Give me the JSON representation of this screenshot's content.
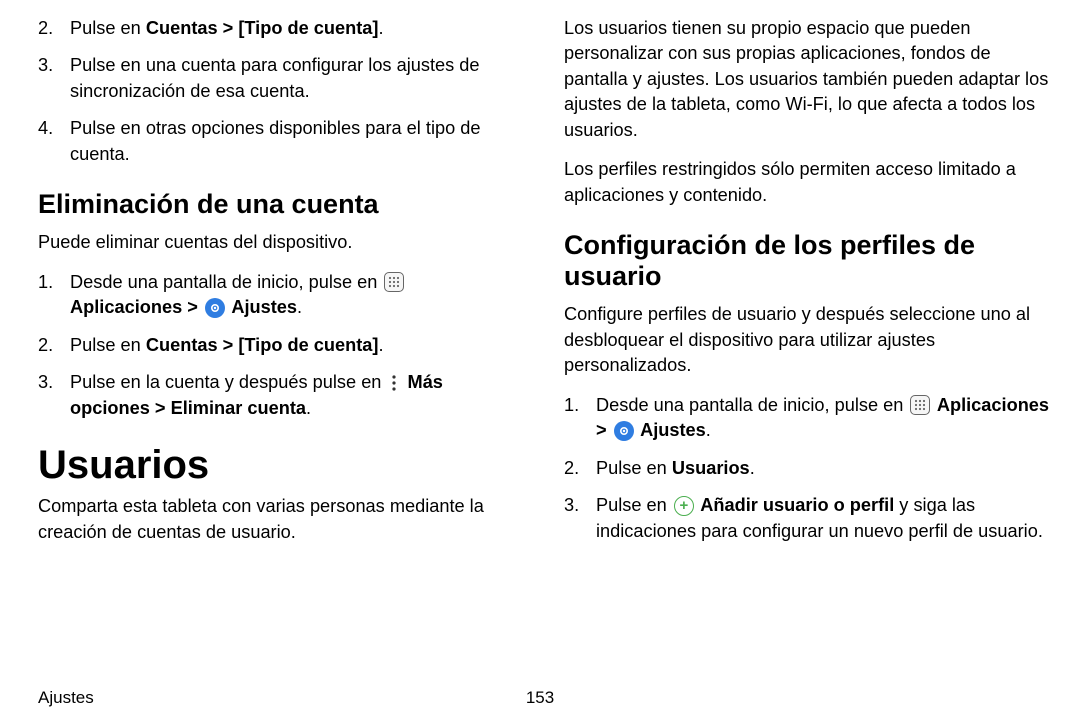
{
  "left": {
    "steps_top": [
      {
        "num": "2.",
        "pre": "Pulse en ",
        "bold": "Cuentas > [Tipo de cuenta]",
        "post": "."
      },
      {
        "num": "3.",
        "pre": "Pulse en una cuenta para configurar los ajustes de sincronización de esa cuenta.",
        "bold": "",
        "post": ""
      },
      {
        "num": "4.",
        "pre": "Pulse en otras opciones disponibles para el tipo de cuenta.",
        "bold": "",
        "post": ""
      }
    ],
    "h2_delete": "Eliminación de una cuenta",
    "p_delete": "Puede eliminar cuentas del dispositivo.",
    "steps_delete": [
      {
        "num": "1.",
        "segments": [
          {
            "t": "Desde una pantalla de inicio, pulse en "
          },
          {
            "icon": "apps"
          },
          {
            "t": " Aplicaciones > ",
            "bold": true
          },
          {
            "icon": "settings"
          },
          {
            "t": " Ajustes",
            "bold": true
          },
          {
            "t": "."
          }
        ]
      },
      {
        "num": "2.",
        "segments": [
          {
            "t": "Pulse en "
          },
          {
            "t": "Cuentas > [Tipo de cuenta]",
            "bold": true
          },
          {
            "t": "."
          }
        ]
      },
      {
        "num": "3.",
        "segments": [
          {
            "t": "Pulse en la cuenta y después pulse en "
          },
          {
            "icon": "more"
          },
          {
            "t": " Más opciones > Eliminar cuenta",
            "bold": true
          },
          {
            "t": "."
          }
        ]
      }
    ],
    "h1_users": "Usuarios",
    "p_users": "Comparta esta tableta con varias personas mediante la creación de cuentas de usuario."
  },
  "right": {
    "p1": "Los usuarios tienen su propio espacio que pueden personalizar con sus propias aplicaciones, fondos de pantalla y ajustes. Los usuarios también pueden adaptar los ajustes de la tableta, como Wi-Fi, lo que afecta a todos los usuarios.",
    "p2": "Los perfiles restringidos sólo permiten acceso limitado a aplicaciones y contenido.",
    "h2_profiles": "Configuración de los perfiles de usuario",
    "p3": "Configure perfiles de usuario y después seleccione uno al desbloquear el dispositivo para utilizar ajustes personalizados.",
    "steps_profiles": [
      {
        "num": "1.",
        "segments": [
          {
            "t": "Desde una pantalla de inicio, pulse en "
          },
          {
            "icon": "apps"
          },
          {
            "t": " Aplicaciones > ",
            "bold": true
          },
          {
            "icon": "settings"
          },
          {
            "t": " Ajustes",
            "bold": true
          },
          {
            "t": "."
          }
        ]
      },
      {
        "num": "2.",
        "segments": [
          {
            "t": "Pulse en "
          },
          {
            "t": "Usuarios",
            "bold": true
          },
          {
            "t": "."
          }
        ]
      },
      {
        "num": "3.",
        "segments": [
          {
            "t": "Pulse en "
          },
          {
            "icon": "add"
          },
          {
            "t": " Añadir usuario o perfil",
            "bold": true
          },
          {
            "t": " y siga las indicaciones para configurar un nuevo perfil de usuario."
          }
        ]
      }
    ]
  },
  "footer": {
    "section": "Ajustes",
    "page": "153"
  }
}
